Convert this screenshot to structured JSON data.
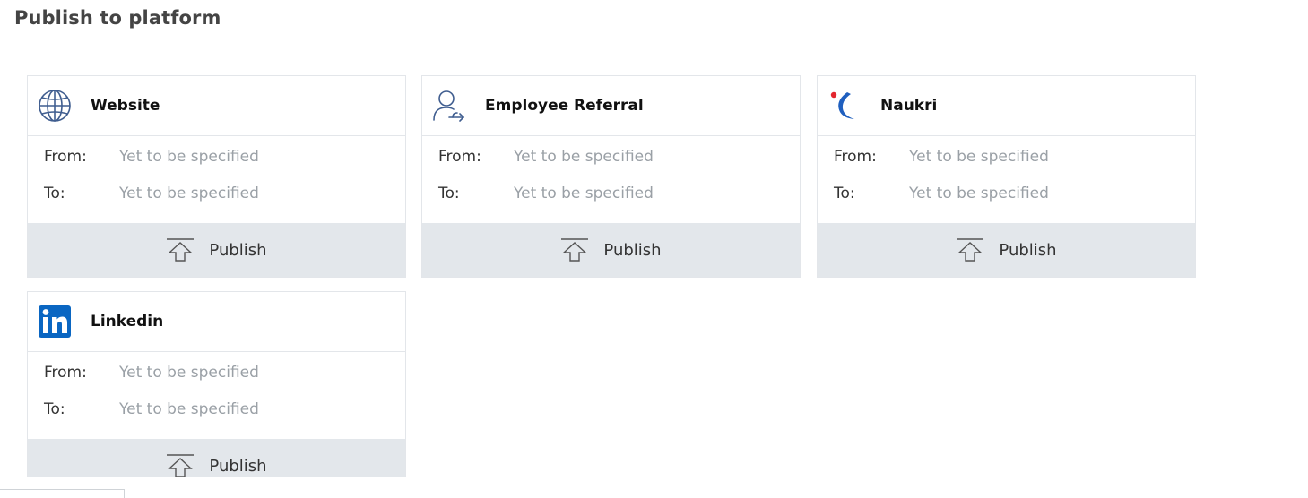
{
  "page": {
    "title": "Publish to platform"
  },
  "cards": [
    {
      "title": "Website",
      "icon": "globe-icon",
      "from_label": "From:",
      "from_value": "Yet to be specified",
      "to_label": "To:",
      "to_value": "Yet to be specified",
      "publish_label": "Publish",
      "publish_icon": "upload-icon"
    },
    {
      "title": "Employee Referral",
      "icon": "user-share-icon",
      "from_label": "From:",
      "from_value": "Yet to be specified",
      "to_label": "To:",
      "to_value": "Yet to be specified",
      "publish_label": "Publish",
      "publish_icon": "upload-icon"
    },
    {
      "title": "Naukri",
      "icon": "naukri-logo-icon",
      "from_label": "From:",
      "from_value": "Yet to be specified",
      "to_label": "To:",
      "to_value": "Yet to be specified",
      "publish_label": "Publish",
      "publish_icon": "upload-icon"
    },
    {
      "title": "Linkedin",
      "icon": "linkedin-logo-icon",
      "from_label": "From:",
      "from_value": "Yet to be specified",
      "to_label": "To:",
      "to_value": "Yet to be specified",
      "publish_label": "Publish",
      "publish_icon": "upload-icon"
    }
  ],
  "colors": {
    "icon_blue": "#3f5d8f",
    "linkedin_blue": "#0a66c2",
    "naukri_blue": "#1f5fbf",
    "naukri_red": "#e3262e",
    "publish_bar_bg": "#e3e7eb",
    "placeholder_text": "#9aa0a6"
  }
}
